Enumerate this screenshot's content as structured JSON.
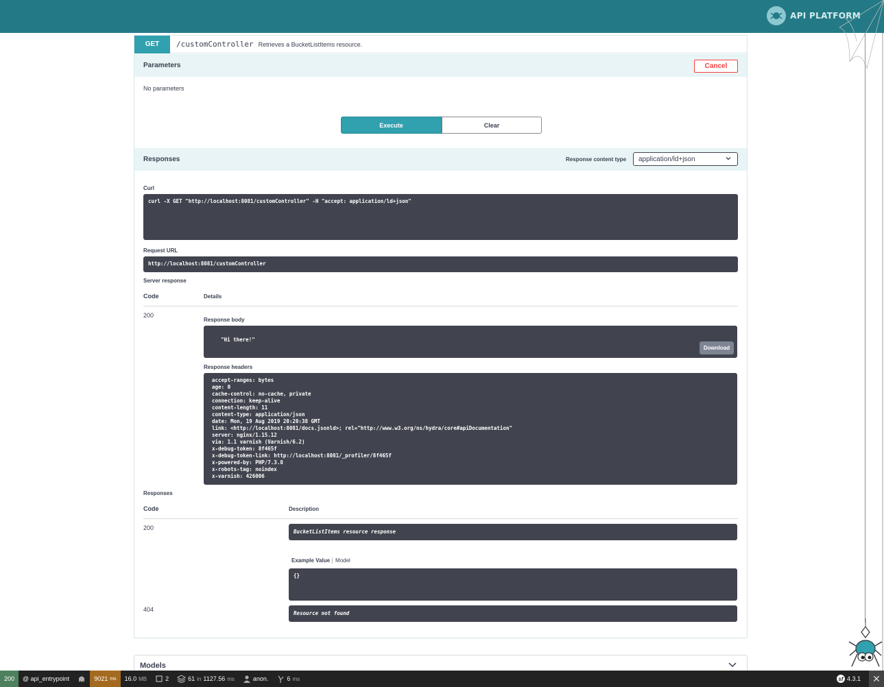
{
  "header": {
    "brand": "API PLATFORM",
    "colors": {
      "bar": "#237a86",
      "accent": "#31a0af",
      "danger": "#f93e3e",
      "code_bg": "#41444e"
    }
  },
  "operation": {
    "method": "GET",
    "path": "/customController",
    "description": "Retrieves a BucketListItems resource."
  },
  "parameters": {
    "title": "Parameters",
    "cancel_label": "Cancel",
    "empty_text": "No parameters",
    "execute_label": "Execute",
    "clear_label": "Clear"
  },
  "responses_section": {
    "title": "Responses",
    "content_type_label": "Response content type",
    "content_type_value": "application/ld+json",
    "curl_label": "Curl",
    "curl_command": "curl -X GET \"http://localhost:8081/customController\" -H \"accept: application/ld+json\"",
    "request_url_label": "Request URL",
    "request_url": "http://localhost:8081/customController",
    "server_response_label": "Server response",
    "code_header": "Code",
    "details_header": "Details",
    "live_code": "200",
    "response_body_label": "Response body",
    "response_body": "\"Hi there!\"",
    "download_label": "Download",
    "response_headers_label": "Response headers",
    "response_headers": [
      "accept-ranges: bytes",
      "age: 0",
      "cache-control: no-cache, private",
      "connection: keep-alive",
      "content-length: 11",
      "content-type: application/json",
      "date: Mon, 19 Aug 2019 20:20:38 GMT",
      "link: <http://localhost:8081/docs.jsonld>; rel=\"http://www.w3.org/ns/hydra/core#apiDocumentation\"",
      "server: nginx/1.15.12",
      "via: 1.1 varnish (Varnish/6.2)",
      "x-debug-token: 8f465f",
      "x-debug-token-link: http://localhost:8081/_profiler/8f465f",
      "x-powered-by: PHP/7.3.8",
      "x-robots-tag: noindex",
      "x-varnish: 426006"
    ]
  },
  "documented_responses": {
    "title": "Responses",
    "code_header": "Code",
    "description_header": "Description",
    "items": [
      {
        "code": "200",
        "description": "BucketListItems resource response",
        "example_tab": "Example Value",
        "model_tab": "Model",
        "example": "{}"
      },
      {
        "code": "404",
        "description": "Resource not found"
      }
    ]
  },
  "models": {
    "title": "Models"
  },
  "debug_toolbar": {
    "status": "200",
    "route": "@ api_entrypoint",
    "time_value": "9021",
    "time_unit": "ms",
    "memory_value": "16.0",
    "memory_unit": "MB",
    "forms": "2",
    "db_queries": "61",
    "db_in": "in",
    "db_time": "1127.56",
    "db_unit": "ms",
    "user": "anon.",
    "render_value": "6",
    "render_unit": "ms",
    "symfony_version": "4.3.1"
  }
}
